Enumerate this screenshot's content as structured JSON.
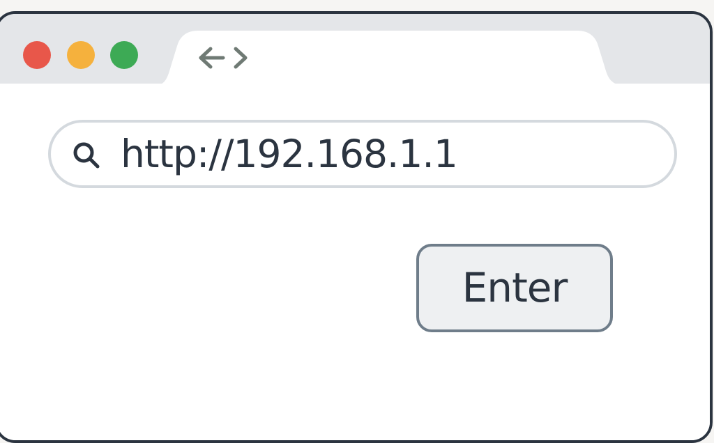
{
  "window": {
    "controls": [
      {
        "name": "close",
        "color": "#e8574a"
      },
      {
        "name": "minimize",
        "color": "#f5b13d"
      },
      {
        "name": "maximize",
        "color": "#3daa55"
      }
    ]
  },
  "toolbar": {
    "nav_icon": "back-forward-arrows-icon"
  },
  "address_bar": {
    "icon": "search-icon",
    "value": "http://192.168.1.1"
  },
  "enter_button": {
    "label": "Enter"
  },
  "colors": {
    "frame": "#2b3440",
    "titlebar": "#e4e6e9",
    "button_border": "#6f7d8a",
    "button_fill": "#eef0f2",
    "urlbar_border": "#d4d9de"
  }
}
